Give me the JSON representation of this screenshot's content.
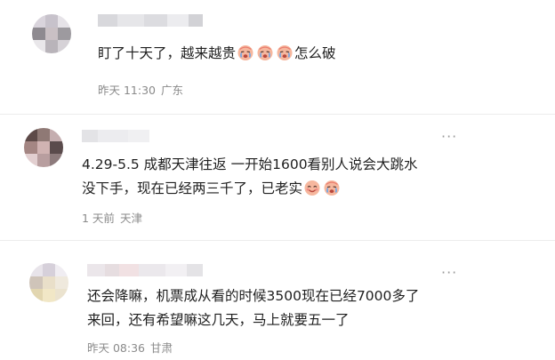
{
  "comments": [
    {
      "text_before": "盯了十天了，越来越贵",
      "emojis": [
        "crying-face-icon",
        "crying-face-icon",
        "crying-face-icon"
      ],
      "text_after": "怎么破",
      "time": "昨天 11:30",
      "location": "广东",
      "avatar_colors": [
        "#d9d4dc",
        "#c7c2cb",
        "#e6e3e8",
        "#8e8a90",
        "#c9c0c4",
        "#9d9a9f",
        "#e9e7ea",
        "#b9b4ba",
        "#d6d2d7"
      ]
    },
    {
      "line1": "4.29-5.5 成都天津往返 一开始1600看别人说会大跳水",
      "line2_before": "没下手，现在已经两三千了，已老实",
      "emojis": [
        "smiling-face-icon",
        "crying-face-icon"
      ],
      "time": "1 天前",
      "location": "天津",
      "more": "···",
      "avatar_colors": [
        "#5d4a48",
        "#8f7975",
        "#c5aeb0",
        "#a48683",
        "#d0b3b2",
        "#5a4b4c",
        "#e2cfd0",
        "#b89e9f",
        "#8d7b7c"
      ]
    },
    {
      "line1": "还会降嘛，机票成从看的时候3500现在已经7000多了",
      "line2": "来回，还有希望嘛这几天，马上就要五一了",
      "time": "昨天 08:36",
      "location": "甘肃",
      "more": "···",
      "avatar_colors": [
        "#e8e4ea",
        "#d6d0da",
        "#f0edf2",
        "#cfc4b9",
        "#e9dfc9",
        "#efe9dd",
        "#e2d6b0",
        "#f1e7c6",
        "#ebe3cf"
      ]
    }
  ],
  "colors": {
    "text": "#1f1f1f",
    "meta": "#8a8a8a",
    "emoji_face": "#f4a58a",
    "emoji_tear": "#6aa6e8"
  }
}
